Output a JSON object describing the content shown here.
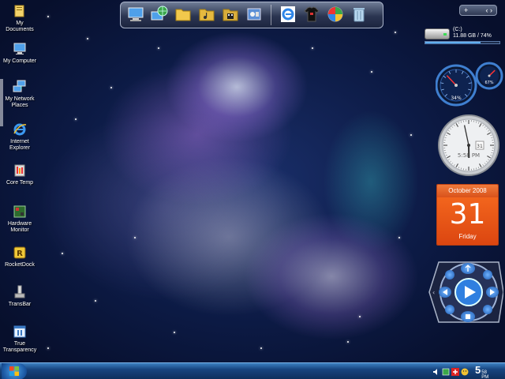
{
  "desktop": {
    "icons": [
      {
        "label": "My Documents",
        "icon": "folder-documents-icon"
      },
      {
        "label": "My Computer",
        "icon": "computer-icon"
      },
      {
        "label": "My Network Places",
        "icon": "network-icon"
      },
      {
        "label": "Internet Explorer",
        "icon": "internet-explorer-icon"
      },
      {
        "label": "Core Temp",
        "icon": "thermometer-icon"
      },
      {
        "label": "Hardware Monitor",
        "icon": "hardware-monitor-icon"
      },
      {
        "label": "RocketDock",
        "icon": "rocketdock-icon"
      },
      {
        "label": "TransBar",
        "icon": "transbar-icon"
      },
      {
        "label": "True Transparency",
        "icon": "true-transparency-icon"
      }
    ]
  },
  "dock": {
    "items": [
      "computer-icon",
      "network-globe-icon",
      "folder-icon",
      "folder-music-icon",
      "folder-video-icon",
      "control-panel-icon",
      "internet-explorer-icon",
      "tshirt-icon",
      "windows-update-icon",
      "recycle-bin-icon"
    ]
  },
  "sidebar": {
    "add_label": "+",
    "nav_label": "‹ ›",
    "drive": {
      "name": "(C:)",
      "info": "11.88 GB / 74%",
      "used_fraction": 0.74
    },
    "gauges": {
      "cpu_percent": "34%",
      "memory_percent": "67%",
      "cpu_fraction": 0.34,
      "memory_fraction": 0.67
    },
    "clock": {
      "time": "5:58 PM",
      "date_badge": "31",
      "hour": 5,
      "minute": 58
    },
    "calendar": {
      "month_year": "October 2008",
      "day": "31",
      "weekday": "Friday"
    }
  },
  "taskbar": {
    "clock_time": "5",
    "clock_minutes": "58",
    "clock_ampm": "PM",
    "tray_icons": [
      "volume-icon",
      "network-status-icon",
      "core-temp-icon",
      "messenger-icon"
    ]
  },
  "colors": {
    "taskbar": "#17447f",
    "calendar": "#f2651d",
    "background": "#0c1a44"
  }
}
